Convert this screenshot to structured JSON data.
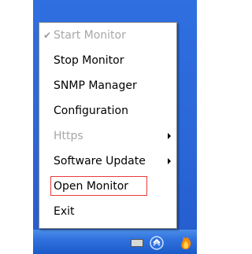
{
  "menu": {
    "items": [
      {
        "label": "Start Monitor",
        "disabled": true,
        "checked": true
      },
      {
        "label": "Stop Monitor"
      },
      {
        "label": "SNMP Manager"
      },
      {
        "label": "Configuration"
      },
      {
        "label": "Https",
        "disabled": true,
        "submenu": true
      },
      {
        "label": "Software Update",
        "submenu": true
      },
      {
        "label": "Open Monitor",
        "highlighted": true
      },
      {
        "label": "Exit"
      }
    ]
  },
  "colors": {
    "desktop_blue": "#2a66d6",
    "disabled_text": "#a7a7a7",
    "highlight_border": "#e63c3c"
  },
  "icons": {
    "check": "checkmark-icon",
    "submenu": "submenu-arrow-icon",
    "tray": [
      "keyboard-icon",
      "network-arrows-icon",
      "flame-icon"
    ]
  }
}
